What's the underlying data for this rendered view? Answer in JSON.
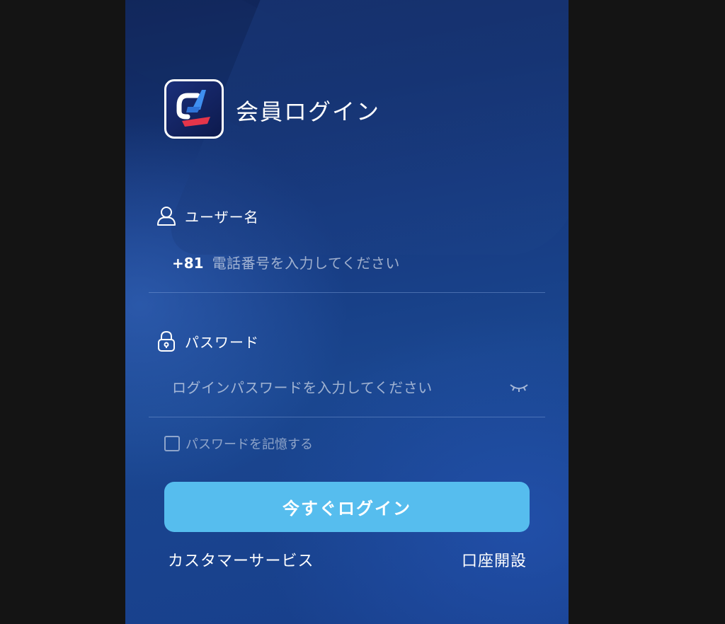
{
  "header": {
    "title": "会員ログイン",
    "logo_icon": "app-logo-icon"
  },
  "username": {
    "label": "ユーザー名",
    "icon": "user-icon",
    "country_code": "+81",
    "placeholder": "電話番号を入力してください",
    "value": ""
  },
  "password": {
    "label": "パスワード",
    "icon": "lock-icon",
    "placeholder": "ログインパスワードを入力してください",
    "value": "",
    "toggle_icon": "eye-closed-icon"
  },
  "remember": {
    "label": "パスワードを記憶する",
    "checked": false
  },
  "actions": {
    "login_label": "今すぐログイン",
    "customer_service_label": "カスタマーサービス",
    "open_account_label": "口座開設"
  },
  "colors": {
    "accent": "#56bdee",
    "background": "#16397f"
  }
}
